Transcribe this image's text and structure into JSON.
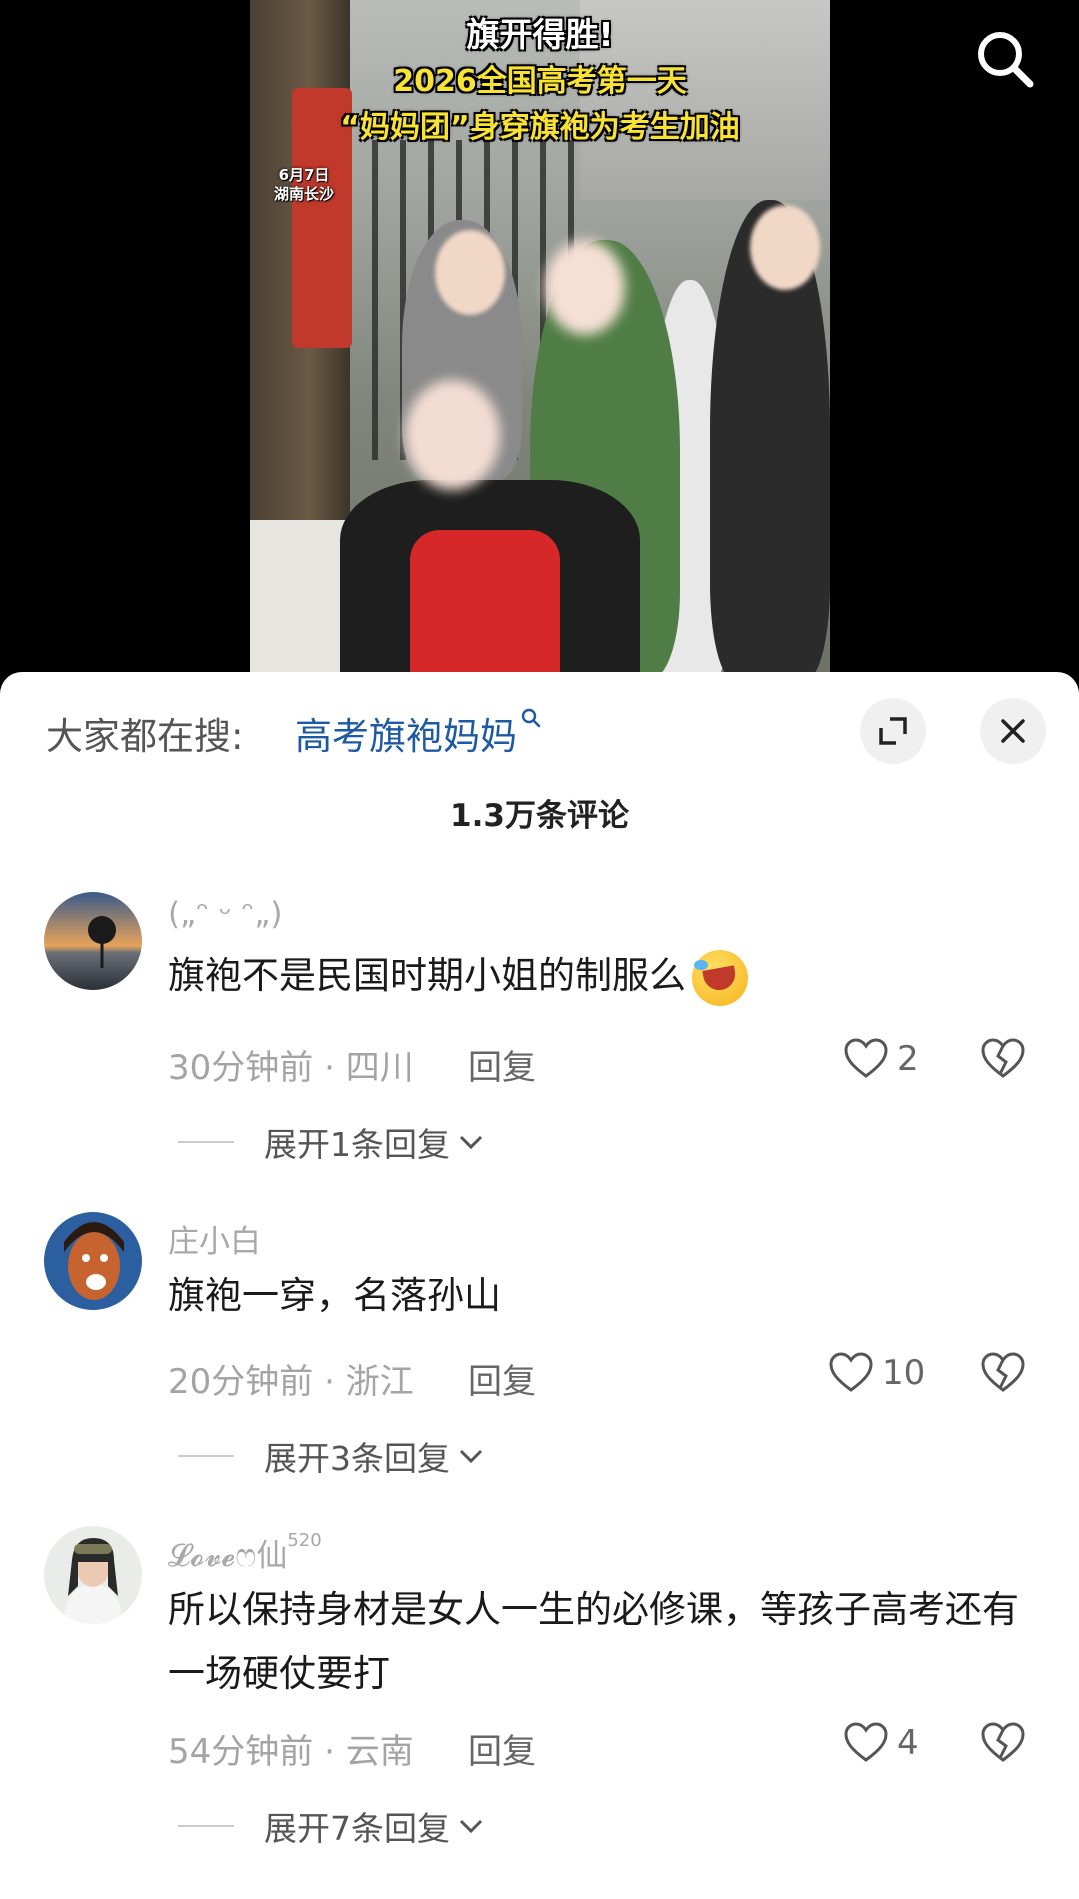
{
  "video": {
    "title_line1": "旗开得胜!",
    "title_line2": "2026全国高考第一天",
    "title_line3": "“妈妈团”身穿旗袍为考生加油",
    "date": "6月7日",
    "place": "湖南长沙",
    "search_icon": "search-icon"
  },
  "sheet": {
    "hot_search_label": "大家都在搜:",
    "hot_search_term": "高考旗袍妈妈",
    "comment_count": "1.3万条评论",
    "expand_icon": "expand-icon",
    "close_icon": "close-icon"
  },
  "comments": [
    {
      "username": "(„ᵔ ᵕ ᵔ„)",
      "text": "旗袍不是民国时期小姐的制服么",
      "time": "30分钟前",
      "location": "四川",
      "reply_label": "回复",
      "likes": "2",
      "expand_label": "展开1条回复"
    },
    {
      "username": "庄小白",
      "text": "旗袍一穿，名落孙山",
      "time": "20分钟前",
      "location": "浙江",
      "reply_label": "回复",
      "likes": "10",
      "expand_label": "展开3条回复"
    },
    {
      "username": "𝓛𝓸𝓿𝓮ෆ仙",
      "username_sup": "520",
      "text": "所以保持身材是女人一生的必修课，等孩子高考还有一场硬仗要打",
      "time": "54分钟前",
      "location": "云南",
      "reply_label": "回复",
      "likes": "4",
      "expand_label": "展开7条回复"
    }
  ],
  "meta_separator": " · "
}
